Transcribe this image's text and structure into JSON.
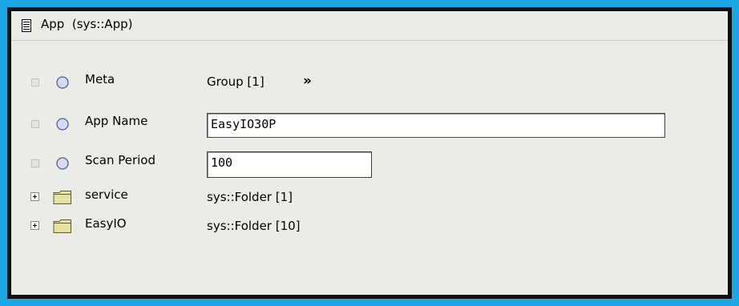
{
  "header": {
    "title": "App  (sys::App)",
    "icon": "document-icon"
  },
  "rows": [
    {
      "name": "Meta",
      "value": "Group [1]",
      "icon": "slot-icon",
      "action_icon": "double-chevron-right-icon"
    },
    {
      "name": "App Name",
      "value": "EasyIO30P",
      "icon": "slot-icon",
      "editable": true
    },
    {
      "name": "Scan Period",
      "value": "100",
      "icon": "slot-icon",
      "editable": true
    },
    {
      "name": "service",
      "value": "sys::Folder [1]",
      "icon": "folder-icon",
      "expandable": true
    },
    {
      "name": "EasyIO",
      "value": "sys::Folder [10]",
      "icon": "folder-icon",
      "expandable": true
    }
  ],
  "colors": {
    "frame_accent": "#1ba7e3",
    "panel_bg": "#ecece7",
    "folder": "#e8e2a0"
  }
}
